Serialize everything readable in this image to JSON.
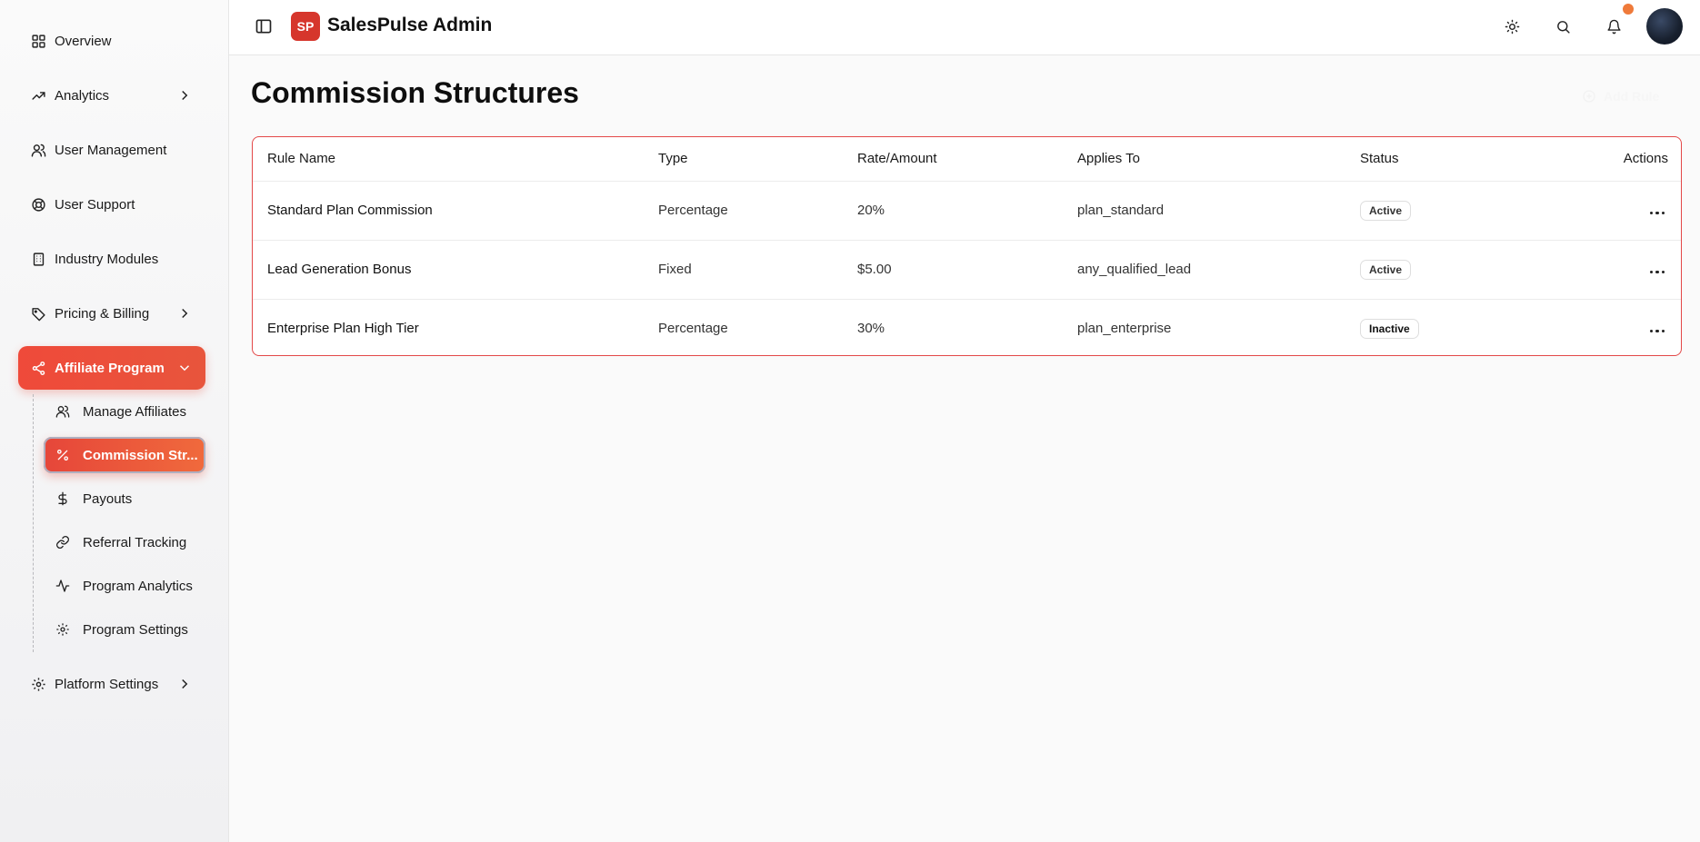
{
  "app": {
    "logo": "SP",
    "title": "SalesPulse Admin"
  },
  "sidebar": {
    "items": [
      {
        "label": "Overview",
        "icon": "grid-icon"
      },
      {
        "label": "Analytics",
        "icon": "trend-up-icon"
      },
      {
        "label": "User Management",
        "icon": "users-icon"
      },
      {
        "label": "User Support",
        "icon": "lifebuoy-icon"
      },
      {
        "label": "Industry Modules",
        "icon": "building-icon"
      },
      {
        "label": "Pricing & Billing",
        "icon": "tag-icon"
      },
      {
        "label": "Affiliate Program",
        "icon": "share-icon"
      },
      {
        "label": "Platform Settings",
        "icon": "gear-icon"
      }
    ],
    "affiliate_sub": [
      {
        "label": "Manage Affiliates",
        "icon": "users-icon"
      },
      {
        "label": "Commission Str...",
        "icon": "percent-icon"
      },
      {
        "label": "Payouts",
        "icon": "dollar-icon"
      },
      {
        "label": "Referral Tracking",
        "icon": "link-icon"
      },
      {
        "label": "Program Analytics",
        "icon": "activity-icon"
      },
      {
        "label": "Program Settings",
        "icon": "gear-icon"
      }
    ]
  },
  "page": {
    "title": "Commission Structures",
    "add_label": "Add Rule"
  },
  "table": {
    "headers": [
      "Rule Name",
      "Type",
      "Rate/Amount",
      "Applies To",
      "Status",
      "Actions"
    ],
    "rows": [
      {
        "name": "Standard Plan Commission",
        "type": "Percentage",
        "rate": "20%",
        "applies": "plan_standard",
        "status": "Active"
      },
      {
        "name": "Lead Generation Bonus",
        "type": "Fixed",
        "rate": "$5.00",
        "applies": "any_qualified_lead",
        "status": "Active"
      },
      {
        "name": "Enterprise Plan High Tier",
        "type": "Percentage",
        "rate": "30%",
        "applies": "plan_enterprise",
        "status": "Inactive"
      }
    ]
  },
  "colors": {
    "accent": "#e8463a",
    "logo_bg": "#d6362c",
    "notification_dot": "#ef7a3a"
  }
}
